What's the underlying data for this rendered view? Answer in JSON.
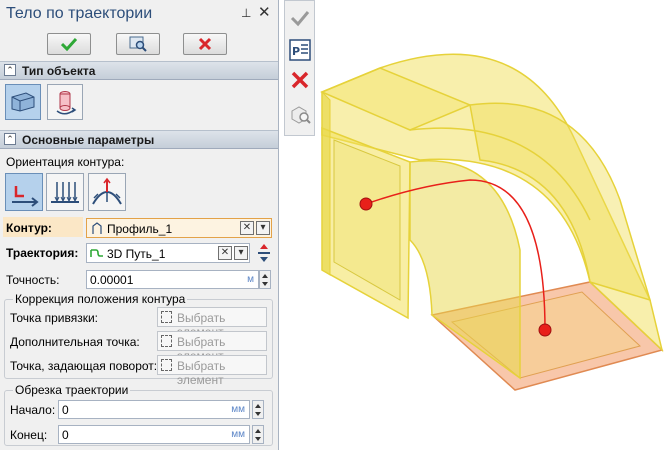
{
  "panel": {
    "title": "Тело по траектории",
    "pin_glyph": "⊥",
    "close_glyph": "✕"
  },
  "toolbar": {
    "ok_icon": "check-icon",
    "preview_icon": "preview-icon",
    "cancel_icon": "cancel-icon"
  },
  "sections": {
    "object_type": "Тип объекта",
    "main_params": "Основные параметры"
  },
  "orientation_label": "Ориентация контура:",
  "contour": {
    "label": "Контур:",
    "value": "Профиль_1"
  },
  "trajectory": {
    "label": "Траектория:",
    "value": "3D Путь_1"
  },
  "accuracy": {
    "label": "Точность:",
    "value": "0.00001",
    "unit": "м"
  },
  "correction_group": {
    "title": "Коррекция положения  контура",
    "rows": [
      {
        "label": "Точка привязки:",
        "button": "Выбрать элемент"
      },
      {
        "label": "Дополнительная точка:",
        "button": "Выбрать элемент"
      },
      {
        "label": "Точка, задающая поворот:",
        "button": "Выбрать элемент"
      }
    ]
  },
  "trim_group": {
    "title": "Обрезка траектории",
    "start": {
      "label": "Начало:",
      "value": "0",
      "unit": "мм"
    },
    "end": {
      "label": "Конец:",
      "value": "0",
      "unit": "мм"
    }
  },
  "colors": {
    "title_blue": "#2d4e7a",
    "ok_green": "#2ea836",
    "cancel_red": "#d9262b",
    "highlight_orange": "#e3a248",
    "body_yellow": "#f2e05a",
    "path_red": "#e8201a"
  }
}
